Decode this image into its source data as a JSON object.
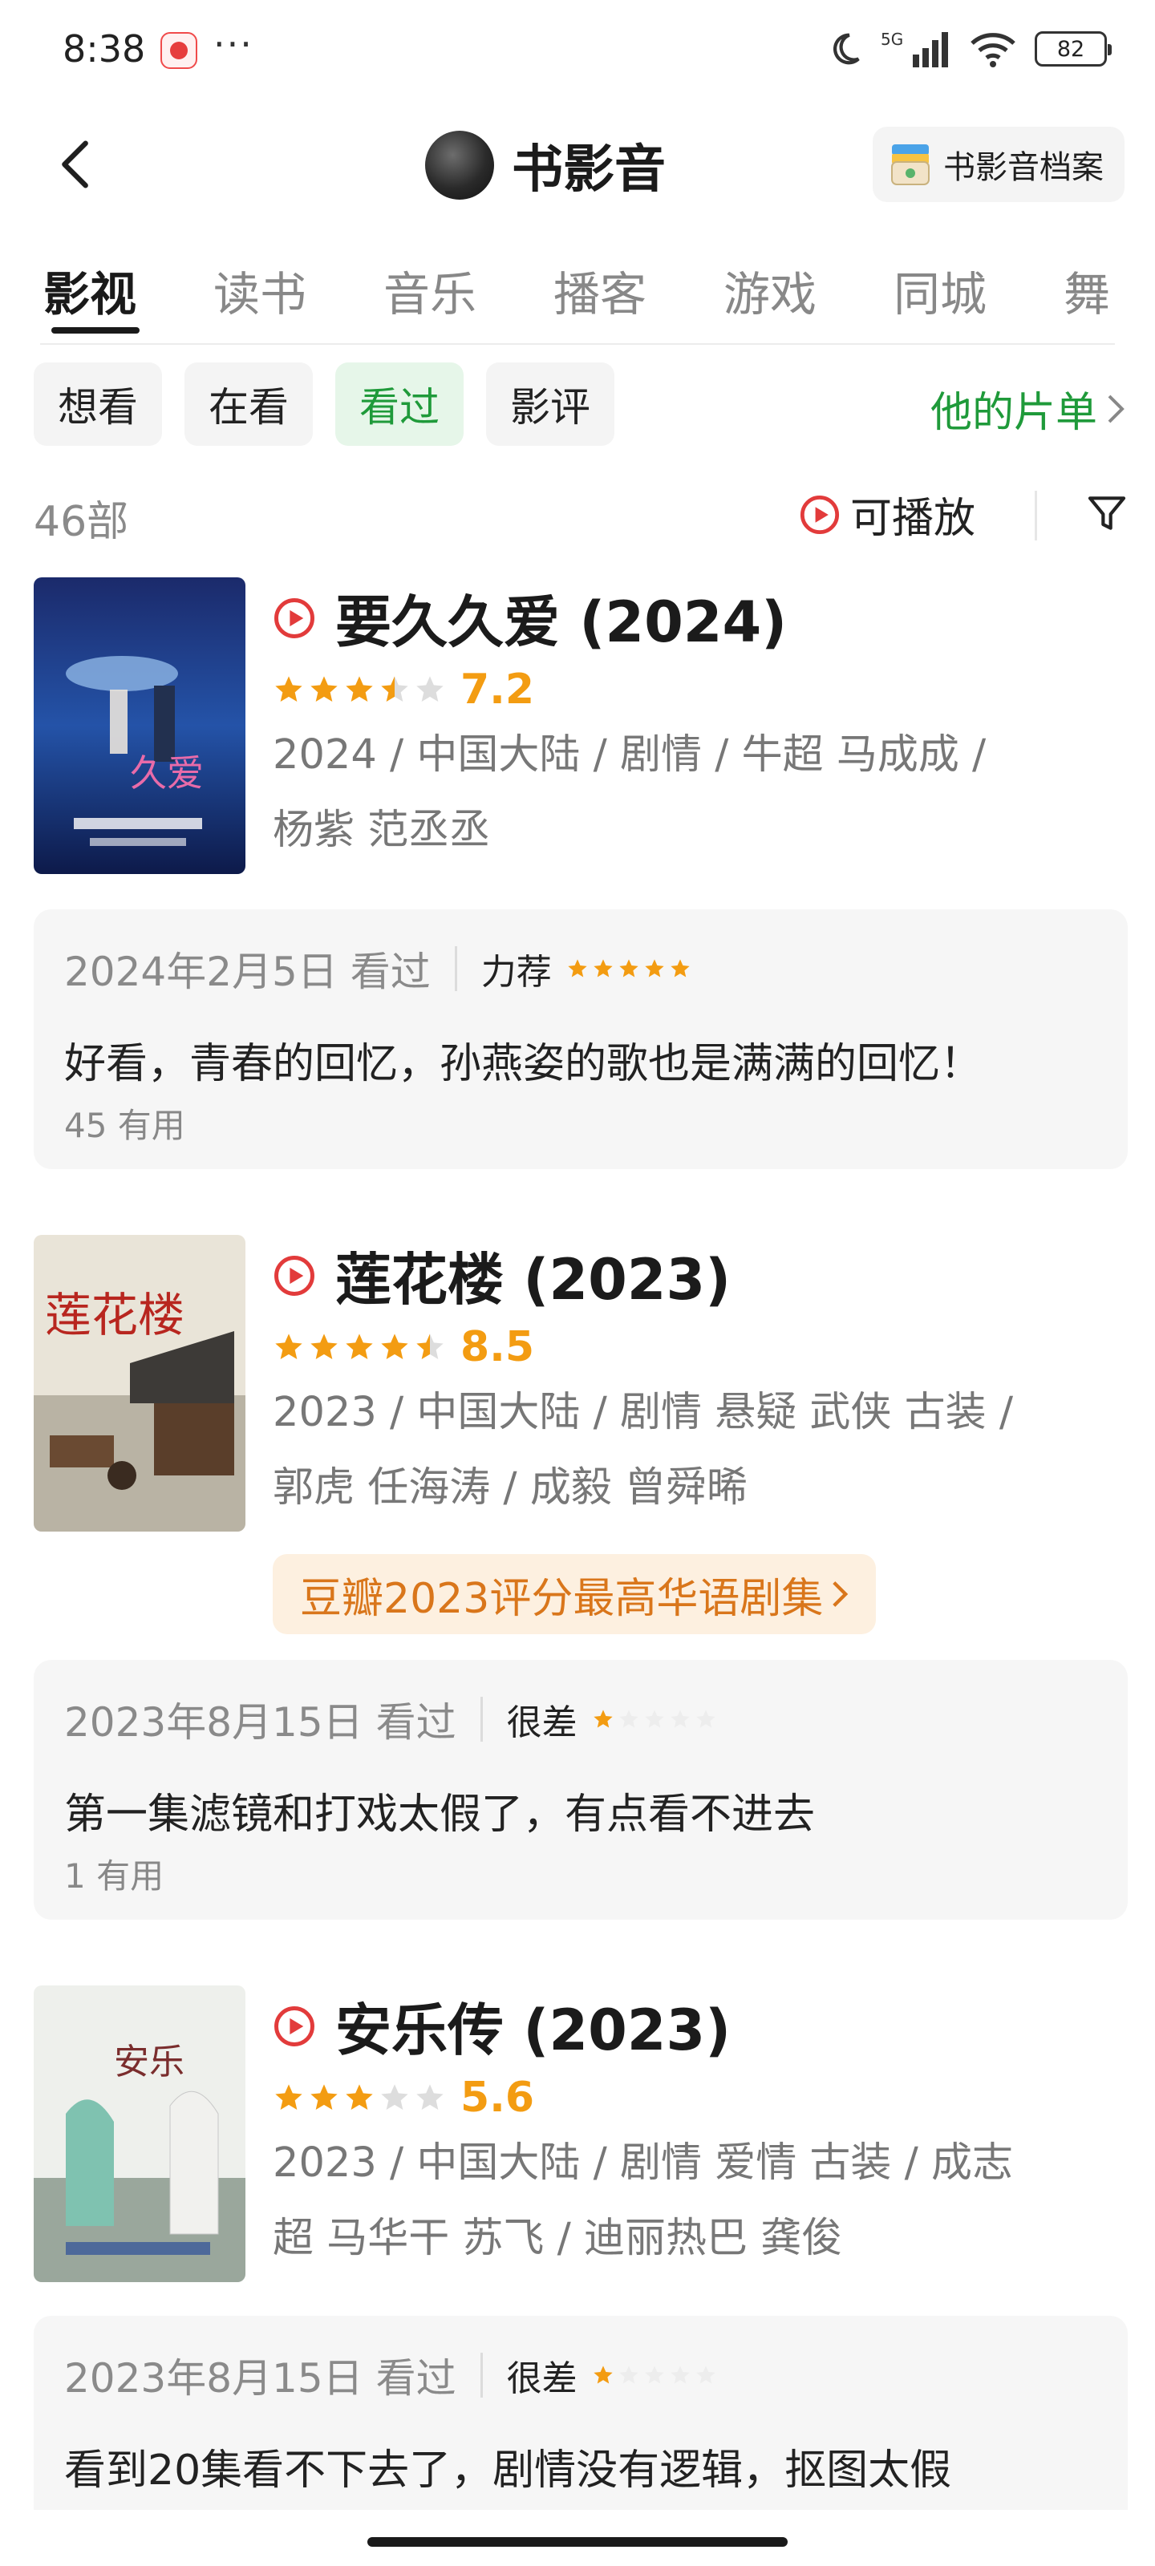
{
  "status_bar": {
    "time": "8:38",
    "more": "···",
    "network": "5G",
    "battery": "82"
  },
  "header": {
    "title": "书影音",
    "archive_label": "书影音档案"
  },
  "tabs": [
    {
      "label": "影视",
      "active": true
    },
    {
      "label": "读书",
      "active": false
    },
    {
      "label": "音乐",
      "active": false
    },
    {
      "label": "播客",
      "active": false
    },
    {
      "label": "游戏",
      "active": false
    },
    {
      "label": "同城",
      "active": false
    },
    {
      "label": "舞",
      "active": false
    }
  ],
  "filters": [
    {
      "label": "想看",
      "active": false
    },
    {
      "label": "在看",
      "active": false
    },
    {
      "label": "看过",
      "active": true
    },
    {
      "label": "影评",
      "active": false
    }
  ],
  "list_link": "他的片单",
  "count": "46部",
  "playable_label": "可播放",
  "colors": {
    "accent_green": "#1f9a3a",
    "star_orange": "#f39c12",
    "play_red": "#e23b3b"
  },
  "items": [
    {
      "title": "要久久爱 (2024)",
      "score": "7.2",
      "stars": 3.5,
      "meta_line1": "2024 / 中国大陆 / 剧情 / 牛超 马成成 /",
      "meta_line2": "杨紫 范丞丞",
      "review": {
        "date": "2024年2月5日 看过",
        "rating_label": "力荐",
        "rating_stars": 5,
        "text": "好看，青春的回忆，孙燕姿的歌也是满满的回忆！",
        "useful": "45 有用"
      }
    },
    {
      "title": "莲花楼 (2023)",
      "score": "8.5",
      "stars": 4.5,
      "meta_line1": "2023 / 中国大陆 / 剧情 悬疑 武侠 古装 /",
      "meta_line2": "郭虎 任海涛 / 成毅 曾舜晞",
      "badge": "豆瓣2023评分最高华语剧集",
      "review": {
        "date": "2023年8月15日 看过",
        "rating_label": "很差",
        "rating_stars": 1,
        "text": "第一集滤镜和打戏太假了，有点看不进去",
        "useful": "1 有用"
      }
    },
    {
      "title": "安乐传 (2023)",
      "score": "5.6",
      "stars": 3,
      "meta_line1": "2023 / 中国大陆 / 剧情 爱情 古装 / 成志",
      "meta_line2": "超 马华干 苏飞 / 迪丽热巴 龚俊",
      "review": {
        "date": "2023年8月15日 看过",
        "rating_label": "很差",
        "rating_stars": 1,
        "text": "看到20集看不下去了，剧情没有逻辑，抠图太假"
      }
    }
  ]
}
